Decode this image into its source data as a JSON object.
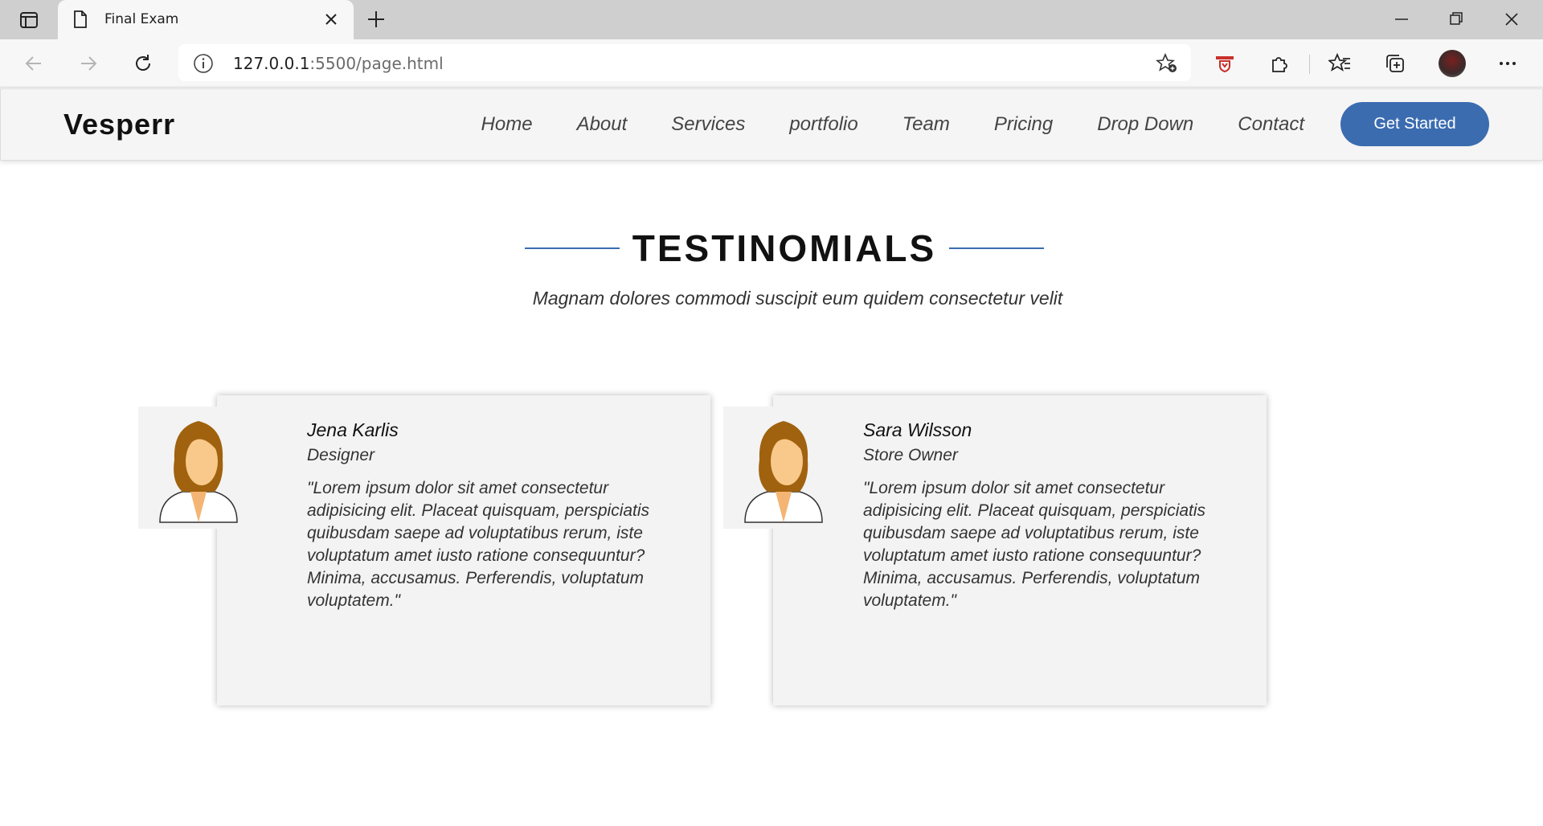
{
  "browser": {
    "tab_title": "Final Exam",
    "url_host": "127.0.0.1",
    "url_rest": ":5500/page.html"
  },
  "site": {
    "logo": "Vesperr",
    "nav": [
      "Home",
      "About",
      "Services",
      "portfolio",
      "Team",
      "Pricing",
      "Drop Down",
      "Contact"
    ],
    "cta": "Get Started",
    "accent": "#3b6cb0"
  },
  "testimonials": {
    "title": "TESTINOMIALS",
    "subtitle": "Magnam dolores commodi suscipit eum quidem consectetur velit",
    "items": [
      {
        "name": "Jena Karlis",
        "role": "Designer",
        "quote": "\"Lorem ipsum dolor sit amet consectetur adipisicing elit. Placeat quisquam, perspiciatis quibusdam saepe ad voluptatibus rerum, iste voluptatum amet iusto ratione consequuntur? Minima, accusamus. Perferendis, voluptatum voluptatem.\""
      },
      {
        "name": "Sara Wilsson",
        "role": "Store Owner",
        "quote": "\"Lorem ipsum dolor sit amet consectetur adipisicing elit. Placeat quisquam, perspiciatis quibusdam saepe ad voluptatibus rerum, iste voluptatum amet iusto ratione consequuntur? Minima, accusamus. Perferendis, voluptatum voluptatem.\""
      }
    ]
  }
}
